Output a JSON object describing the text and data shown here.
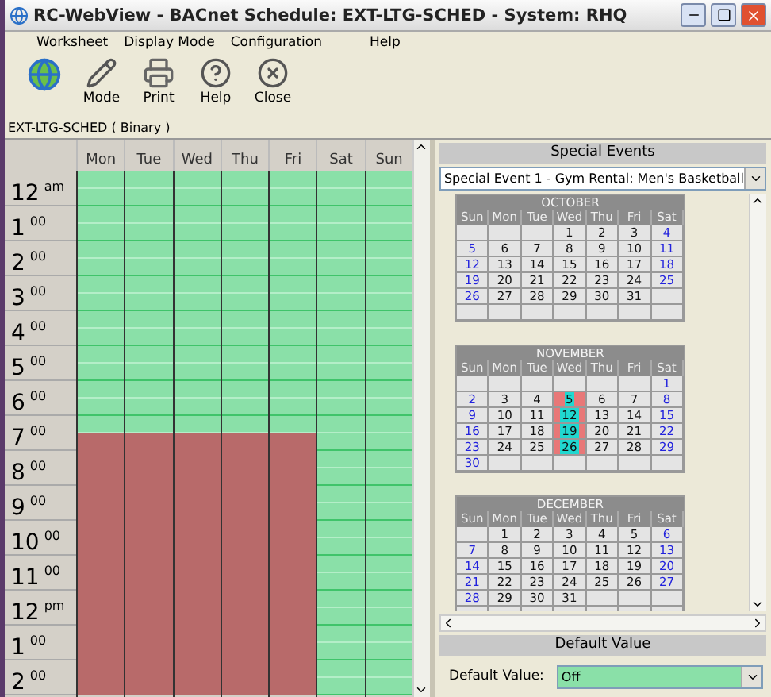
{
  "window": {
    "title": "RC-WebView - BACnet Schedule: EXT-LTG-SCHED - System: RHQ"
  },
  "menu": [
    {
      "label": "Worksheet"
    },
    {
      "label": "Display Mode"
    },
    {
      "label": "Configuration"
    },
    {
      "label": "Help"
    }
  ],
  "toolbar": [
    {
      "kind": "globe"
    },
    {
      "kind": "mode",
      "label": "Mode"
    },
    {
      "kind": "print",
      "label": "Print"
    },
    {
      "kind": "help",
      "label": "Help"
    },
    {
      "kind": "close",
      "label": "Close"
    }
  ],
  "object_label": "EXT-LTG-SCHED ( Binary )",
  "schedule": {
    "days": [
      "Mon",
      "Tue",
      "Wed",
      "Thu",
      "Fri",
      "Sat",
      "Sun"
    ],
    "hours": [
      {
        "hour": "12",
        "suffix": "am"
      },
      {
        "hour": "1",
        "suffix": "00"
      },
      {
        "hour": "2",
        "suffix": "00"
      },
      {
        "hour": "3",
        "suffix": "00"
      },
      {
        "hour": "4",
        "suffix": "00"
      },
      {
        "hour": "5",
        "suffix": "00"
      },
      {
        "hour": "6",
        "suffix": "00"
      },
      {
        "hour": "7",
        "suffix": "00"
      },
      {
        "hour": "8",
        "suffix": "00"
      },
      {
        "hour": "9",
        "suffix": "00"
      },
      {
        "hour": "10",
        "suffix": "00"
      },
      {
        "hour": "11",
        "suffix": "00"
      },
      {
        "hour": "12",
        "suffix": "pm"
      },
      {
        "hour": "1",
        "suffix": "00"
      },
      {
        "hour": "2",
        "suffix": "00"
      }
    ],
    "on": [
      [
        false,
        false,
        false,
        false,
        false,
        false,
        false,
        false,
        false,
        false,
        false,
        false,
        false,
        false,
        false,
        true,
        true,
        true,
        true,
        true,
        true,
        true,
        true,
        true,
        true,
        true,
        true,
        true,
        true,
        true
      ],
      [
        false,
        false,
        false,
        false,
        false,
        false,
        false,
        false,
        false,
        false,
        false,
        false,
        false,
        false,
        false,
        true,
        true,
        true,
        true,
        true,
        true,
        true,
        true,
        true,
        true,
        true,
        true,
        true,
        true,
        true
      ],
      [
        false,
        false,
        false,
        false,
        false,
        false,
        false,
        false,
        false,
        false,
        false,
        false,
        false,
        false,
        false,
        true,
        true,
        true,
        true,
        true,
        true,
        true,
        true,
        true,
        true,
        true,
        true,
        true,
        true,
        true
      ],
      [
        false,
        false,
        false,
        false,
        false,
        false,
        false,
        false,
        false,
        false,
        false,
        false,
        false,
        false,
        false,
        true,
        true,
        true,
        true,
        true,
        true,
        true,
        true,
        true,
        true,
        true,
        true,
        true,
        true,
        true
      ],
      [
        false,
        false,
        false,
        false,
        false,
        false,
        false,
        false,
        false,
        false,
        false,
        false,
        false,
        false,
        false,
        true,
        true,
        true,
        true,
        true,
        true,
        true,
        true,
        true,
        true,
        true,
        true,
        true,
        true,
        true
      ],
      [
        false,
        false,
        false,
        false,
        false,
        false,
        false,
        false,
        false,
        false,
        false,
        false,
        false,
        false,
        false,
        false,
        false,
        false,
        false,
        false,
        false,
        false,
        false,
        false,
        false,
        false,
        false,
        false,
        false,
        false
      ],
      [
        false,
        false,
        false,
        false,
        false,
        false,
        false,
        false,
        false,
        false,
        false,
        false,
        false,
        false,
        false,
        false,
        false,
        false,
        false,
        false,
        false,
        false,
        false,
        false,
        false,
        false,
        false,
        false,
        false,
        false
      ]
    ]
  },
  "special_events": {
    "title": "Special Events",
    "selection": "Special Event 1 - Gym Rental: Men's Basketball",
    "months": [
      {
        "name": "OCTOBER",
        "weekdays": [
          "Sun",
          "Mon",
          "Tue",
          "Wed",
          "Thu",
          "Fri",
          "Sat"
        ],
        "weeks": [
          [
            {
              "kind": "blank"
            },
            {
              "kind": "blank"
            },
            {
              "kind": "blank"
            },
            {
              "kind": "day",
              "d": "1",
              "event": false
            },
            {
              "kind": "day",
              "d": "2",
              "event": false
            },
            {
              "kind": "day",
              "d": "3",
              "event": false
            },
            {
              "kind": "day",
              "d": "4",
              "event": false
            }
          ],
          [
            {
              "kind": "day",
              "d": "5",
              "event": false
            },
            {
              "kind": "day",
              "d": "6",
              "event": false
            },
            {
              "kind": "day",
              "d": "7",
              "event": false
            },
            {
              "kind": "day",
              "d": "8",
              "event": false
            },
            {
              "kind": "day",
              "d": "9",
              "event": false
            },
            {
              "kind": "day",
              "d": "10",
              "event": false
            },
            {
              "kind": "day",
              "d": "11",
              "event": false
            }
          ],
          [
            {
              "kind": "day",
              "d": "12",
              "event": false
            },
            {
              "kind": "day",
              "d": "13",
              "event": false
            },
            {
              "kind": "day",
              "d": "14",
              "event": false
            },
            {
              "kind": "day",
              "d": "15",
              "event": false
            },
            {
              "kind": "day",
              "d": "16",
              "event": false
            },
            {
              "kind": "day",
              "d": "17",
              "event": false
            },
            {
              "kind": "day",
              "d": "18",
              "event": false
            }
          ],
          [
            {
              "kind": "day",
              "d": "19",
              "event": false
            },
            {
              "kind": "day",
              "d": "20",
              "event": false
            },
            {
              "kind": "day",
              "d": "21",
              "event": false
            },
            {
              "kind": "day",
              "d": "22",
              "event": false
            },
            {
              "kind": "day",
              "d": "23",
              "event": false
            },
            {
              "kind": "day",
              "d": "24",
              "event": false
            },
            {
              "kind": "day",
              "d": "25",
              "event": false
            }
          ],
          [
            {
              "kind": "day",
              "d": "26",
              "event": false
            },
            {
              "kind": "day",
              "d": "27",
              "event": false
            },
            {
              "kind": "day",
              "d": "28",
              "event": false
            },
            {
              "kind": "day",
              "d": "29",
              "event": false
            },
            {
              "kind": "day",
              "d": "30",
              "event": false
            },
            {
              "kind": "day",
              "d": "31",
              "event": false
            },
            {
              "kind": "blank"
            }
          ],
          [
            {
              "kind": "blank"
            },
            {
              "kind": "blank"
            },
            {
              "kind": "blank"
            },
            {
              "kind": "blank"
            },
            {
              "kind": "blank"
            },
            {
              "kind": "blank"
            },
            {
              "kind": "blank"
            }
          ]
        ]
      },
      {
        "name": "NOVEMBER",
        "weekdays": [
          "Sun",
          "Mon",
          "Tue",
          "Wed",
          "Thu",
          "Fri",
          "Sat"
        ],
        "weeks": [
          [
            {
              "kind": "blank"
            },
            {
              "kind": "blank"
            },
            {
              "kind": "blank"
            },
            {
              "kind": "blank"
            },
            {
              "kind": "blank"
            },
            {
              "kind": "blank"
            },
            {
              "kind": "day",
              "d": "1",
              "event": false
            }
          ],
          [
            {
              "kind": "day",
              "d": "2",
              "event": false
            },
            {
              "kind": "day",
              "d": "3",
              "event": false
            },
            {
              "kind": "day",
              "d": "4",
              "event": false
            },
            {
              "kind": "day",
              "d": "5",
              "event": true
            },
            {
              "kind": "day",
              "d": "6",
              "event": false
            },
            {
              "kind": "day",
              "d": "7",
              "event": false
            },
            {
              "kind": "day",
              "d": "8",
              "event": false
            }
          ],
          [
            {
              "kind": "day",
              "d": "9",
              "event": false
            },
            {
              "kind": "day",
              "d": "10",
              "event": false
            },
            {
              "kind": "day",
              "d": "11",
              "event": false
            },
            {
              "kind": "day",
              "d": "12",
              "event": true
            },
            {
              "kind": "day",
              "d": "13",
              "event": false
            },
            {
              "kind": "day",
              "d": "14",
              "event": false
            },
            {
              "kind": "day",
              "d": "15",
              "event": false
            }
          ],
          [
            {
              "kind": "day",
              "d": "16",
              "event": false
            },
            {
              "kind": "day",
              "d": "17",
              "event": false
            },
            {
              "kind": "day",
              "d": "18",
              "event": false
            },
            {
              "kind": "day",
              "d": "19",
              "event": true
            },
            {
              "kind": "day",
              "d": "20",
              "event": false
            },
            {
              "kind": "day",
              "d": "21",
              "event": false
            },
            {
              "kind": "day",
              "d": "22",
              "event": false
            }
          ],
          [
            {
              "kind": "day",
              "d": "23",
              "event": false
            },
            {
              "kind": "day",
              "d": "24",
              "event": false
            },
            {
              "kind": "day",
              "d": "25",
              "event": false
            },
            {
              "kind": "day",
              "d": "26",
              "event": true
            },
            {
              "kind": "day",
              "d": "27",
              "event": false
            },
            {
              "kind": "day",
              "d": "28",
              "event": false
            },
            {
              "kind": "day",
              "d": "29",
              "event": false
            }
          ],
          [
            {
              "kind": "day",
              "d": "30",
              "event": false
            },
            {
              "kind": "blank"
            },
            {
              "kind": "blank"
            },
            {
              "kind": "blank"
            },
            {
              "kind": "blank"
            },
            {
              "kind": "blank"
            },
            {
              "kind": "blank"
            }
          ]
        ]
      },
      {
        "name": "DECEMBER",
        "weekdays": [
          "Sun",
          "Mon",
          "Tue",
          "Wed",
          "Thu",
          "Fri",
          "Sat"
        ],
        "weeks": [
          [
            {
              "kind": "blank"
            },
            {
              "kind": "day",
              "d": "1",
              "event": false
            },
            {
              "kind": "day",
              "d": "2",
              "event": false
            },
            {
              "kind": "day",
              "d": "3",
              "event": false
            },
            {
              "kind": "day",
              "d": "4",
              "event": false
            },
            {
              "kind": "day",
              "d": "5",
              "event": false
            },
            {
              "kind": "day",
              "d": "6",
              "event": false
            }
          ],
          [
            {
              "kind": "day",
              "d": "7",
              "event": false
            },
            {
              "kind": "day",
              "d": "8",
              "event": false
            },
            {
              "kind": "day",
              "d": "9",
              "event": false
            },
            {
              "kind": "day",
              "d": "10",
              "event": false
            },
            {
              "kind": "day",
              "d": "11",
              "event": false
            },
            {
              "kind": "day",
              "d": "12",
              "event": false
            },
            {
              "kind": "day",
              "d": "13",
              "event": false
            }
          ],
          [
            {
              "kind": "day",
              "d": "14",
              "event": false
            },
            {
              "kind": "day",
              "d": "15",
              "event": false
            },
            {
              "kind": "day",
              "d": "16",
              "event": false
            },
            {
              "kind": "day",
              "d": "17",
              "event": false
            },
            {
              "kind": "day",
              "d": "18",
              "event": false
            },
            {
              "kind": "day",
              "d": "19",
              "event": false
            },
            {
              "kind": "day",
              "d": "20",
              "event": false
            }
          ],
          [
            {
              "kind": "day",
              "d": "21",
              "event": false
            },
            {
              "kind": "day",
              "d": "22",
              "event": false
            },
            {
              "kind": "day",
              "d": "23",
              "event": false
            },
            {
              "kind": "day",
              "d": "24",
              "event": false
            },
            {
              "kind": "day",
              "d": "25",
              "event": false
            },
            {
              "kind": "day",
              "d": "26",
              "event": false
            },
            {
              "kind": "day",
              "d": "27",
              "event": false
            }
          ],
          [
            {
              "kind": "day",
              "d": "28",
              "event": false
            },
            {
              "kind": "day",
              "d": "29",
              "event": false
            },
            {
              "kind": "day",
              "d": "30",
              "event": false
            },
            {
              "kind": "day",
              "d": "31",
              "event": false
            },
            {
              "kind": "blank"
            },
            {
              "kind": "blank"
            },
            {
              "kind": "blank"
            }
          ],
          [
            {
              "kind": "blank"
            },
            {
              "kind": "blank"
            },
            {
              "kind": "blank"
            },
            {
              "kind": "blank"
            },
            {
              "kind": "blank"
            },
            {
              "kind": "blank"
            },
            {
              "kind": "blank"
            }
          ]
        ]
      }
    ]
  },
  "default_value": {
    "title": "Default Value",
    "label": "Default Value:",
    "value": "Off"
  }
}
